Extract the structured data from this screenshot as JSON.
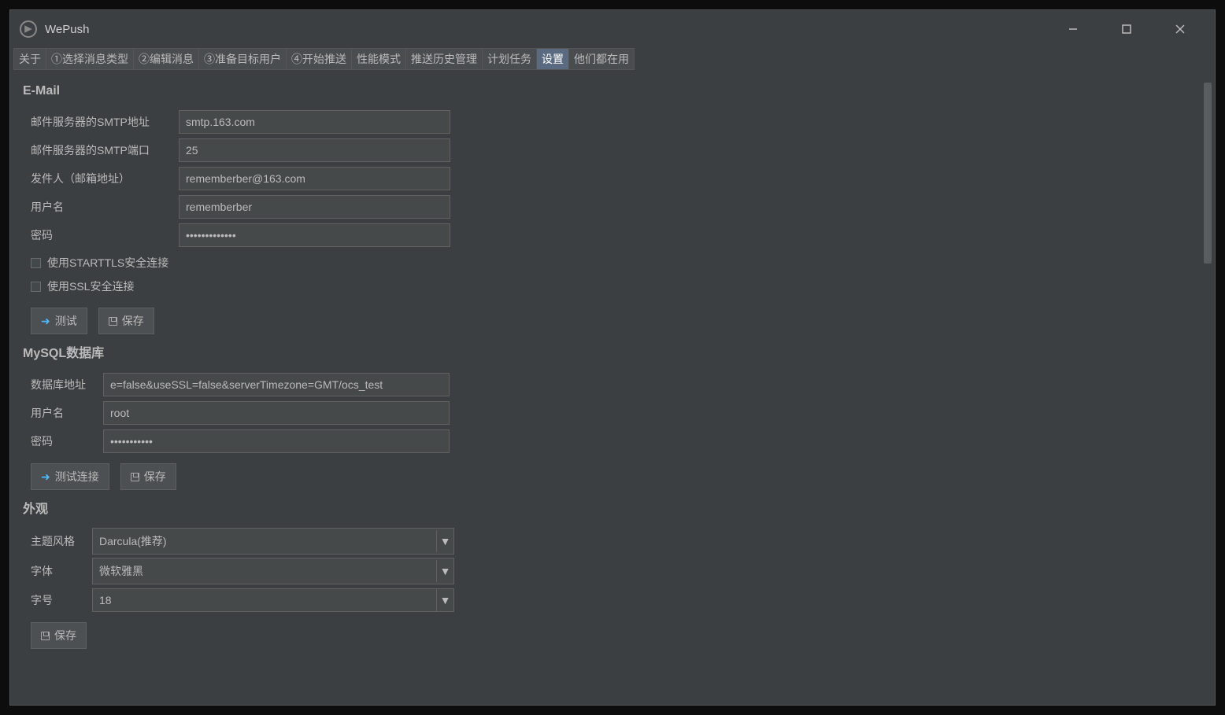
{
  "app": {
    "title": "WePush"
  },
  "tabs": {
    "t0": "关于",
    "t1": "①选择消息类型",
    "t2": "②编辑消息",
    "t3": "③准备目标用户",
    "t4": "④开始推送",
    "t5": "性能模式",
    "t6": "推送历史管理",
    "t7": "计划任务",
    "t8": "设置",
    "t9": "他们都在用"
  },
  "email": {
    "heading": "E-Mail",
    "smtp_addr_label": "邮件服务器的SMTP地址",
    "smtp_addr_value": "smtp.163.com",
    "smtp_port_label": "邮件服务器的SMTP端口",
    "smtp_port_value": "25",
    "sender_label": "发件人（邮箱地址）",
    "sender_value": "rememberber@163.com",
    "user_label": "用户名",
    "user_value": "rememberber",
    "pass_label": "密码",
    "pass_value": "•••••••••••••",
    "starttls_label": "使用STARTTLS安全连接",
    "ssl_label": "使用SSL安全连接",
    "test_btn": "测试",
    "save_btn": "保存"
  },
  "mysql": {
    "heading": "MySQL数据库",
    "addr_label": "数据库地址",
    "addr_value": "e=false&useSSL=false&serverTimezone=GMT/ocs_test",
    "user_label": "用户名",
    "user_value": "root",
    "pass_label": "密码",
    "pass_value": "•••••••••••",
    "test_btn": "测试连接",
    "save_btn": "保存"
  },
  "appearance": {
    "heading": "外观",
    "theme_label": "主题风格",
    "theme_value": "Darcula(推荐)",
    "font_label": "字体",
    "font_value": "微软雅黑",
    "fontsize_label": "字号",
    "fontsize_value": "18",
    "save_btn": "保存"
  }
}
